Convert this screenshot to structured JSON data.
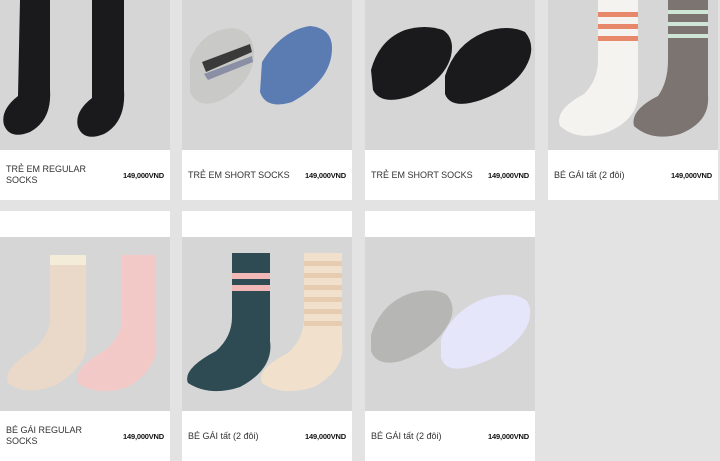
{
  "products": [
    {
      "name": "TRẺ EM REGULAR SOCKS",
      "price": "149,000VND"
    },
    {
      "name": "TRẺ EM SHORT SOCKS",
      "price": "149,000VND"
    },
    {
      "name": "TRẺ EM SHORT SOCKS",
      "price": "149,000VND"
    },
    {
      "name": "BÉ GÁI tất (2 đôi)",
      "price": "149,000VND"
    },
    {
      "name": "BÉ GÁI REGULAR SOCKS",
      "price": "149,000VND"
    },
    {
      "name": "BÉ GÁI tất (2 đôi)",
      "price": "149,000VND"
    },
    {
      "name": "BÉ GÁI tất (2 đôi)",
      "price": "149,000VND"
    }
  ],
  "colors": {
    "page_bg": "#e3e3e3",
    "image_bg": "#d6d6d6",
    "card_bg": "#ffffff"
  }
}
